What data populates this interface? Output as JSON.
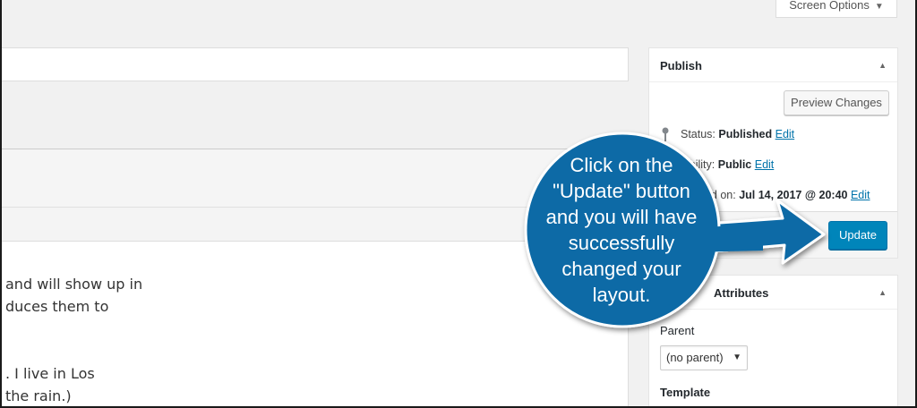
{
  "screen_options": {
    "label": "Screen Options"
  },
  "editor": {
    "lines": [
      "and will show up in",
      "duces them to",
      ". I live in Los",
      " the rain.)"
    ]
  },
  "publish": {
    "title": "Publish",
    "preview_label": "Preview Changes",
    "status_prefix": "Status: ",
    "status_value": "Published",
    "visibility_prefix": "ibility: ",
    "visibility_value": "Public",
    "published_prefix": "hed on: ",
    "published_value": "Jul 14, 2017 @ 20:40",
    "edit_label": "Edit",
    "update_label": "Update"
  },
  "page_attributes": {
    "title": "Attributes",
    "parent_label": "Parent",
    "parent_value": "(no parent)",
    "template_label": "Template"
  },
  "callout": {
    "lines": [
      "Click on the",
      "\"Update\" button",
      "and you will have",
      "successfully",
      "changed your",
      "layout."
    ],
    "color": "#0f6aa6",
    "border": "#ffffff"
  }
}
